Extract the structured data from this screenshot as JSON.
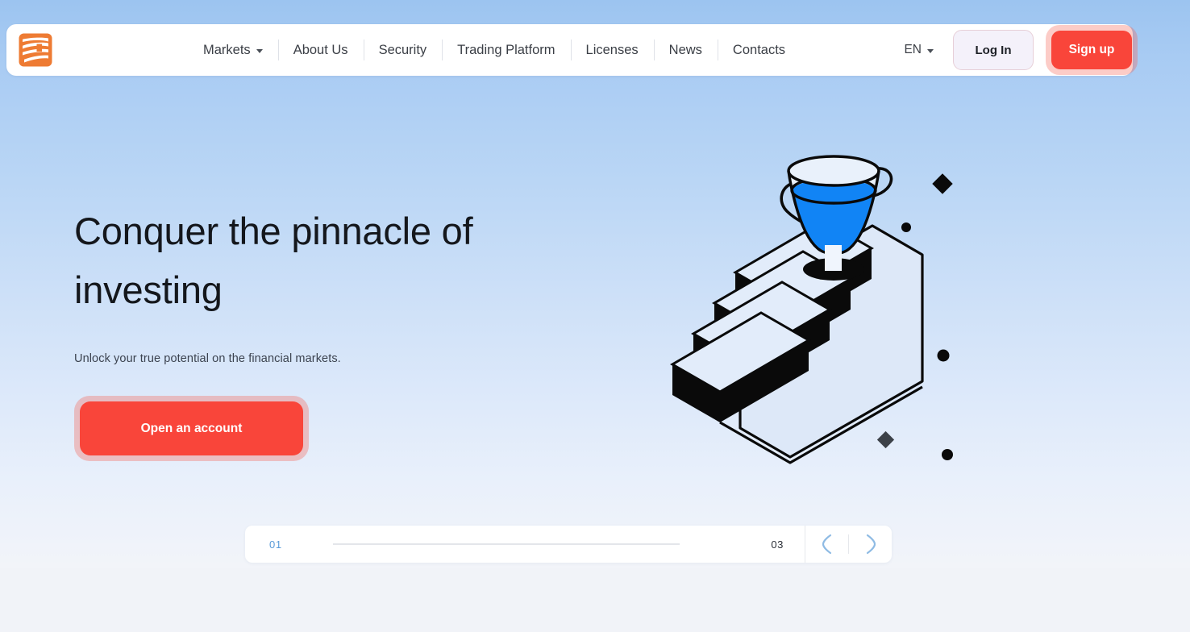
{
  "brand": {
    "logo_icon": "logo-mark-icon",
    "logo_colors": {
      "orange": "#EE7B33",
      "white": "#FFFFFF"
    }
  },
  "header": {
    "nav": [
      {
        "label": "Markets",
        "has_dropdown": true,
        "caret_icon": "chevron-down-icon"
      },
      {
        "label": "About Us",
        "has_dropdown": false
      },
      {
        "label": "Security",
        "has_dropdown": false
      },
      {
        "label": "Trading Platform",
        "has_dropdown": false
      },
      {
        "label": "Licenses",
        "has_dropdown": false
      },
      {
        "label": "News",
        "has_dropdown": false
      },
      {
        "label": "Contacts",
        "has_dropdown": false
      }
    ],
    "language": {
      "label": "EN",
      "caret_icon": "chevron-down-icon"
    },
    "login_label": "Log In",
    "signup_label": "Sign up"
  },
  "hero": {
    "title": "Conquer the pinnacle of\ninvesting",
    "subtitle": "Unlock your true potential on the financial markets.",
    "cta_label": "Open an account",
    "illustration": {
      "name": "trophy-on-stairs-illustration",
      "trophy_color": "#1184F5",
      "stairs_color": "#0A0A0A",
      "tread_color": "#DDE8F8"
    }
  },
  "carousel": {
    "current_slide": "01",
    "total_slides": "03",
    "progress_percent": 0,
    "prev_label": "prev-arrow-icon",
    "next_label": "next-arrow-icon"
  },
  "colors": {
    "accent_red": "#F9453A",
    "accent_blue": "#1184F5",
    "slide_blue": "#5A9BD8",
    "bg_top": "#9CC4F0",
    "bg_bottom": "#F2F4F9",
    "section_bg": "#F1F3F8"
  }
}
